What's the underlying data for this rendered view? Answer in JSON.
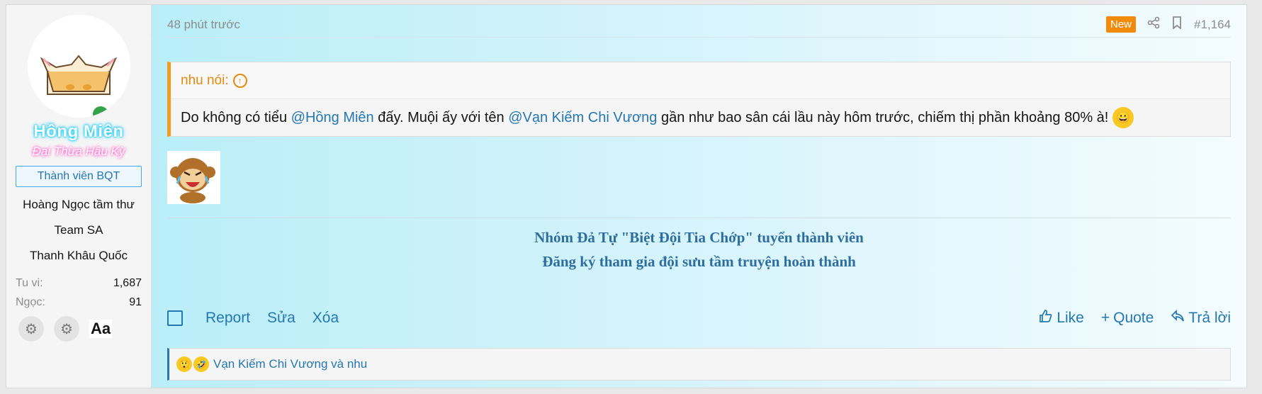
{
  "user": {
    "name": "Hồng Miên",
    "title": "Đại Thừa Hậu Kỳ",
    "banner": "Thành viên BQT",
    "extra": [
      "Hoàng Ngọc tầm thư",
      "Team SA",
      "Thanh Khâu Quốc"
    ],
    "stats": [
      {
        "key": "Tu vi:",
        "value": "1,687"
      },
      {
        "key": "Ngọc:",
        "value": "91"
      }
    ],
    "aa_label": "Aa"
  },
  "post": {
    "time": "48 phút trước",
    "badge": "New",
    "number": "#1,164",
    "quote": {
      "author": "nhu nói:",
      "text_before": "Do không có tiểu ",
      "mention1": "@Hồng Miên",
      "text_mid": " đấy. Muội ấy với tên ",
      "mention2": "@Vạn Kiếm Chi Vương",
      "text_after": " gần như bao sân cái lầu này hôm trước, chiếm thị phần khoảng 80% à!"
    },
    "signature": {
      "line1": "Nhóm Đả Tự \"Biệt Đội Tia Chớp\" tuyển thành viên",
      "line2": "Đăng ký tham gia đội sưu tầm truyện hoàn thành"
    },
    "actions_left": {
      "report": "Report",
      "edit": "Sửa",
      "delete": "Xóa"
    },
    "actions_right": {
      "like": "Like",
      "quote": "Quote",
      "reply": "Trả lời"
    },
    "reactions_text": "Vạn Kiếm Chi Vương và nhu"
  },
  "colors": {
    "accent": "#2577b1",
    "quote_border": "#f29a1c",
    "badge_new": "#f28a0b",
    "online": "#35a34a"
  }
}
